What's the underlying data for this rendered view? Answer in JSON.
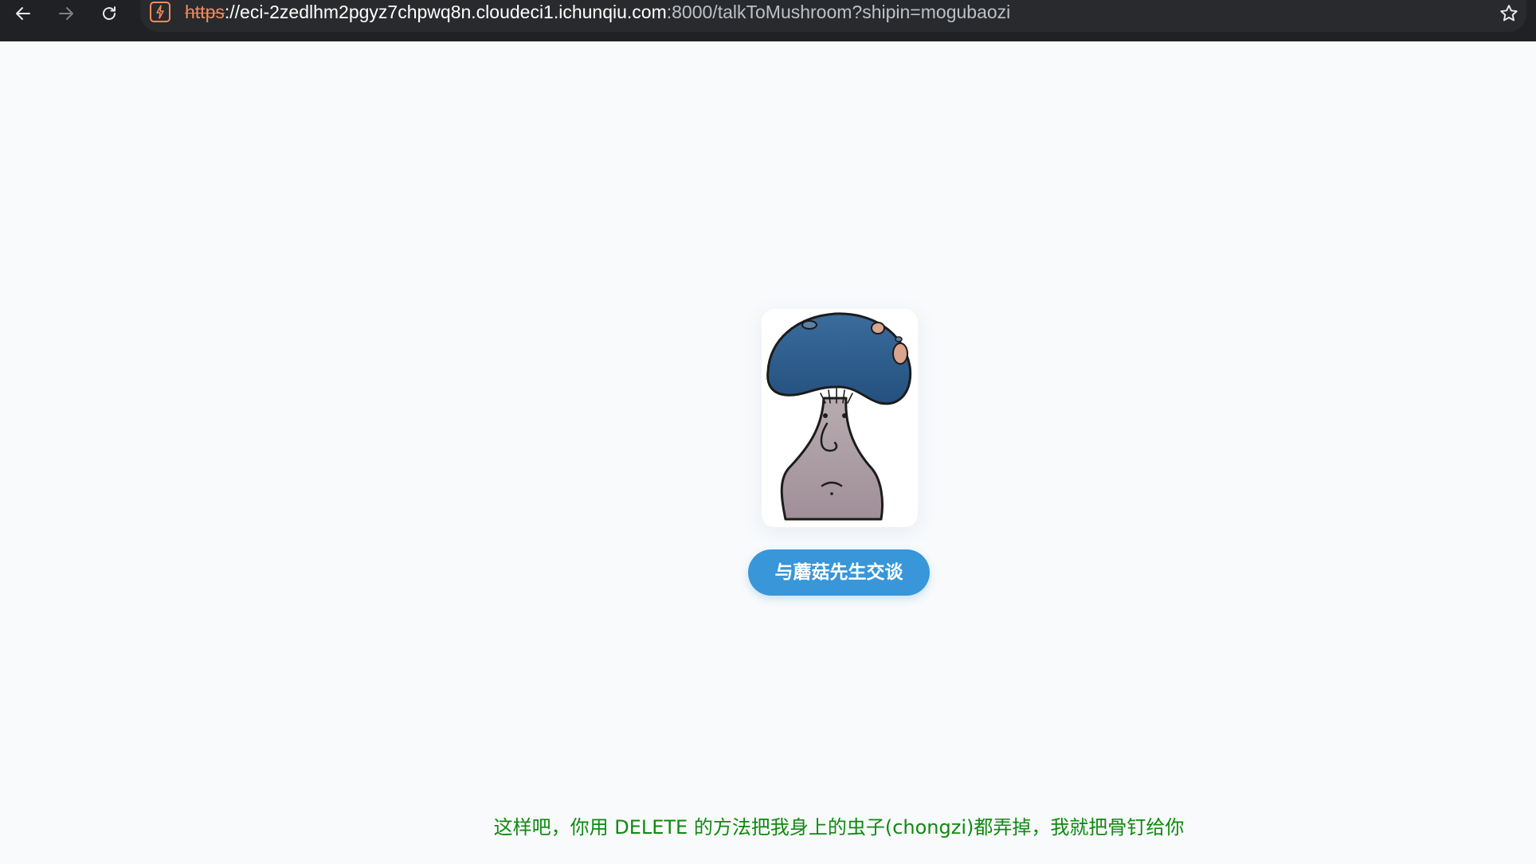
{
  "browser": {
    "url_scheme": "https",
    "url_host": "://eci-2zedlhm2pgyz7chpwq8n.cloudeci1.ichunqiu.com",
    "url_path": ":8000/talkToMushroom?shipin=mogubaozi",
    "icons": {
      "back": "arrow-left-icon",
      "forward": "arrow-right-icon",
      "reload": "reload-icon",
      "site_info": "not-secure-icon",
      "bookmark": "star-icon"
    }
  },
  "page": {
    "image_alt": "mushroom",
    "talk_button_label": "与蘑菇先生交谈",
    "message": "这样吧，你用 DELETE 的方法把我身上的虫子(chongzi)都弄掉，我就把骨钉给你"
  },
  "colors": {
    "page_background": "#f8fafc",
    "button": "#3896d9",
    "message_text": "#0f8a0f",
    "toolbar": "#202124"
  }
}
